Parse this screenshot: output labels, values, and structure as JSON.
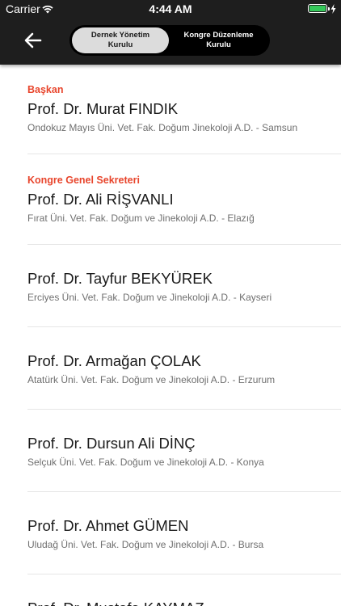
{
  "status_bar": {
    "carrier": "Carrier",
    "time": "4:44 AM"
  },
  "header": {
    "segments": [
      {
        "label": "Dernek Yönetim Kurulu",
        "selected": true
      },
      {
        "label": "Kongre Düzenleme Kurulu",
        "selected": false
      }
    ]
  },
  "colors": {
    "header_bg": "#1e1e1e",
    "role_accent": "#e8452c",
    "battery": "#34c759"
  },
  "members": [
    {
      "role": "Başkan",
      "name": "Prof. Dr. Murat FINDIK",
      "affiliation": "Ondokuz Mayıs Üni. Vet. Fak. Doğum Jinekoloji A.D. - Samsun"
    },
    {
      "role": "Kongre Genel Sekreteri",
      "name": "Prof. Dr. Ali RİŞVANLI",
      "affiliation": "Fırat Üni. Vet. Fak. Doğum ve Jinekoloji A.D. - Elazığ"
    },
    {
      "role": "",
      "name": "Prof. Dr. Tayfur BEKYÜREK",
      "affiliation": "Erciyes Üni. Vet. Fak. Doğum ve Jinekoloji A.D. - Kayseri"
    },
    {
      "role": "",
      "name": "Prof. Dr. Armağan ÇOLAK",
      "affiliation": "Atatürk Üni. Vet. Fak. Doğum ve Jinekoloji A.D. - Erzurum"
    },
    {
      "role": "",
      "name": "Prof. Dr. Dursun Ali DİNÇ",
      "affiliation": "Selçuk Üni. Vet. Fak. Doğum ve Jinekoloji A.D. - Konya"
    },
    {
      "role": "",
      "name": "Prof. Dr. Ahmet GÜMEN",
      "affiliation": "Uludağ Üni. Vet. Fak. Doğum ve Jinekoloji A.D. - Bursa"
    },
    {
      "role": "",
      "name": "Prof. Dr. Mustafa KAYMAZ",
      "affiliation": ""
    }
  ]
}
